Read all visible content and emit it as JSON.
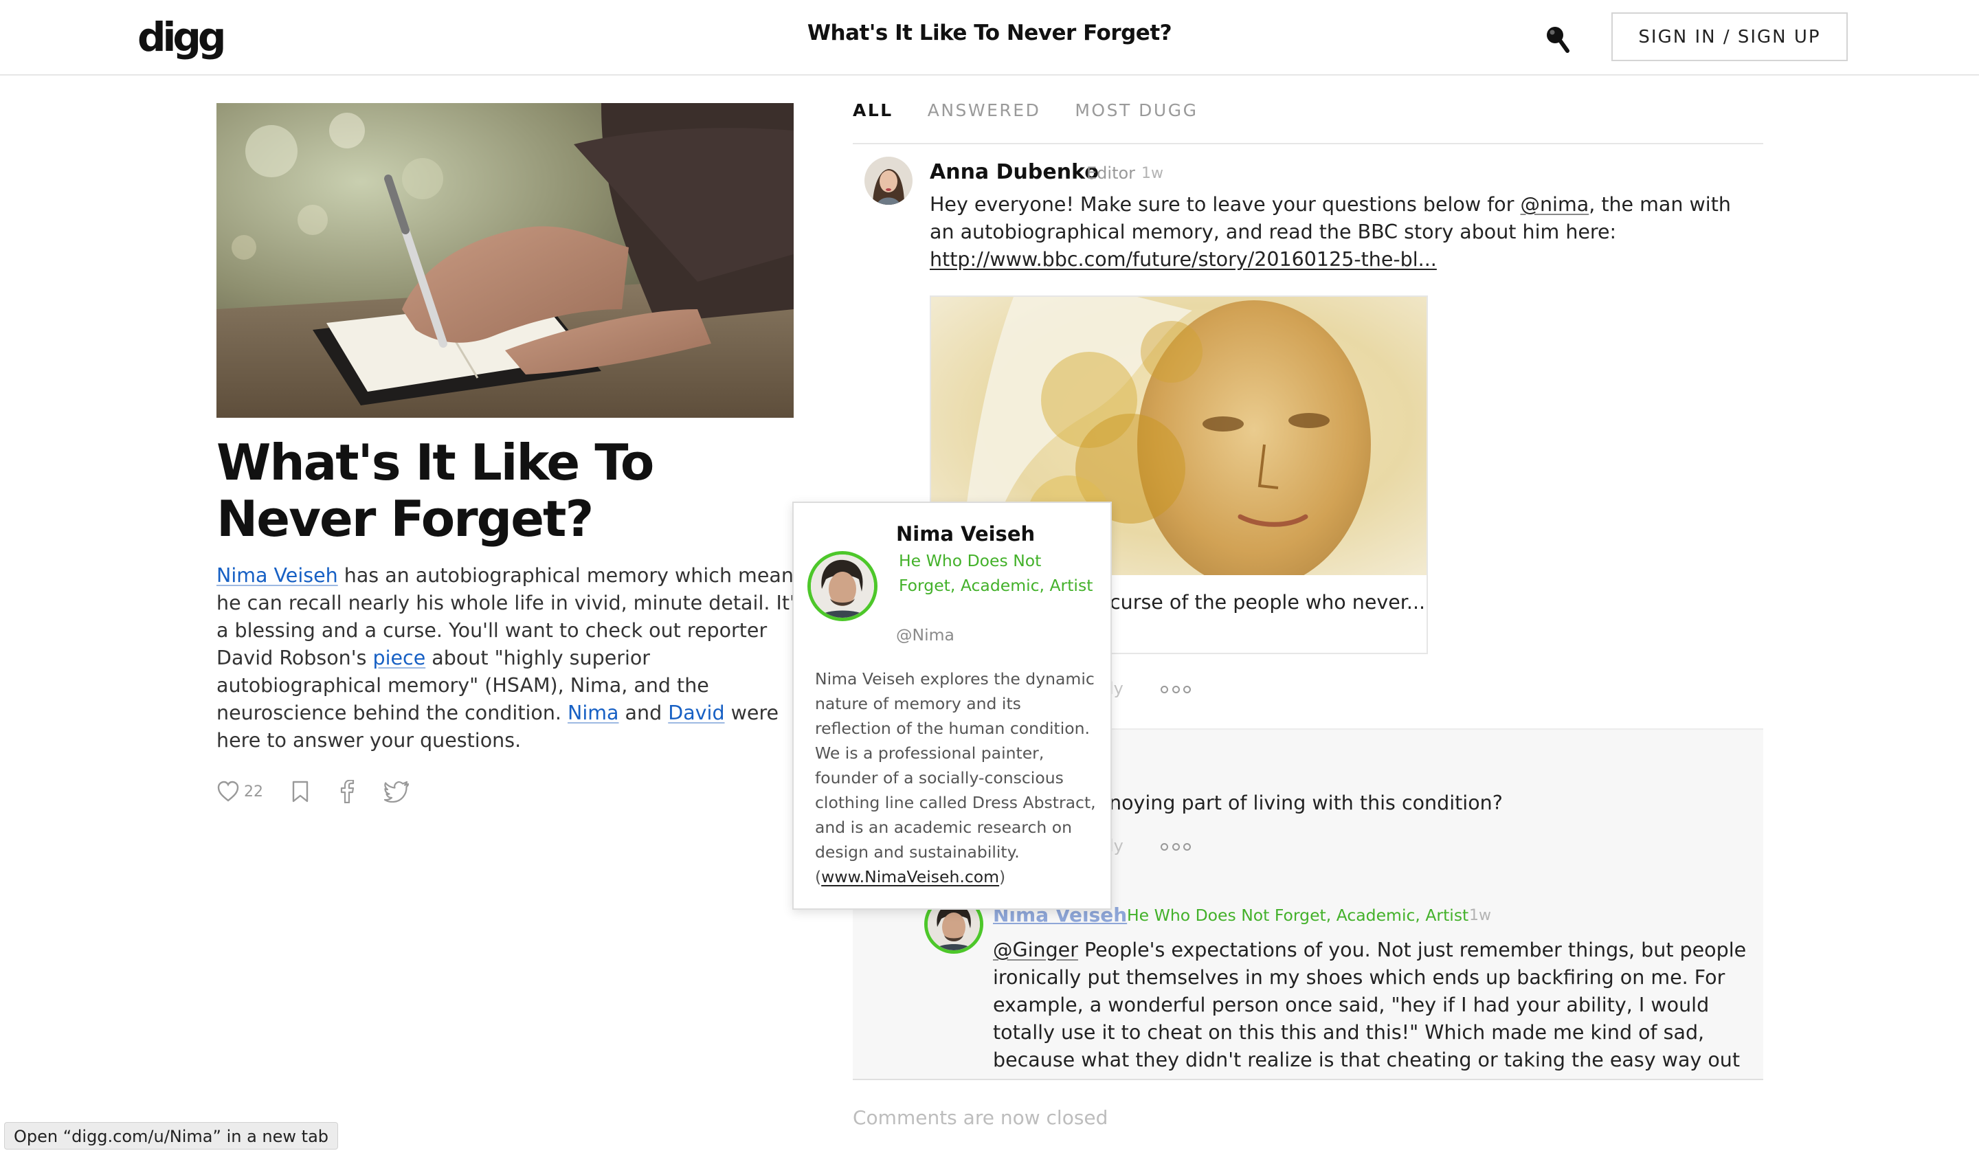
{
  "header": {
    "logo": "digg",
    "title": "What's It Like To Never Forget?",
    "signin_label": "SIGN IN / SIGN UP"
  },
  "article": {
    "title": "What's It Like To Never Forget?",
    "body": {
      "link_nima_veiseh": "Nima Veiseh",
      "t1": " has an autobiographical memory which means he can recall nearly his whole life in vivid, minute detail. It's a blessing and a curse. You'll want to check out reporter David Robson's ",
      "link_piece": "piece",
      "t2": " about \"highly superior autobiographical memory\" (HSAM), Nima, and the neuroscience behind the condition. ",
      "link_nima": "Nima",
      "t3": " and ",
      "link_david": "David",
      "t4": " were here to answer your questions."
    },
    "like_count": "22"
  },
  "tabs": [
    "ALL",
    "ANSWERED",
    "MOST DUGG"
  ],
  "comments": {
    "first": {
      "author": "Anna Dubenko",
      "role": "Editor",
      "time": "1w",
      "text_start": "Hey everyone! Make sure to leave your questions below for ",
      "mention": "@nima",
      "text_mid": ", the man with an autobiographical memory, and read the BBC story about him here: ",
      "link": "http://www.bbc.com/future/story/20160125-the-bl...",
      "embed_caption": "curse of the people who never...",
      "reply_fragment": "ly"
    },
    "question": {
      "text_fragment": "noying part of living with this condition?",
      "reply_fragment": "ly"
    },
    "answer": {
      "author": "Nima Veiseh",
      "title": "He Who Does Not Forget, Academic, Artist",
      "time": "1w",
      "mention": "@Ginger",
      "text": " People's expectations of you. Not just remember things, but people ironically put themselves in my shoes which ends up backfiring on me.  For example, a wonderful person once said, \"hey if I had your ability, I would totally use it to cheat on this this and this!\" Which made me kind of sad, because what they didn't realize is that cheating or taking the easy way out would get very boring and"
    },
    "closed_notice": "Comments are now closed"
  },
  "popover": {
    "name": "Nima Veiseh",
    "title": "He Who Does Not Forget, Academic, Artist",
    "handle": "@Nima",
    "bio": "Nima Veiseh explores the dynamic nature of memory and its reflection of the human condition. We is a professional painter, founder of a socially-conscious clothing line called Dress Abstract, and is an academic research on design and sustainability.",
    "bio_open": "(",
    "website": "www.NimaVeiseh.com",
    "bio_close": ")"
  },
  "status_tooltip": "Open “digg.com/u/Nima” in a new tab",
  "colors": {
    "link_blue": "#1760c4",
    "accent_green": "#43b12a",
    "avatar_ring": "#4dc72a"
  }
}
